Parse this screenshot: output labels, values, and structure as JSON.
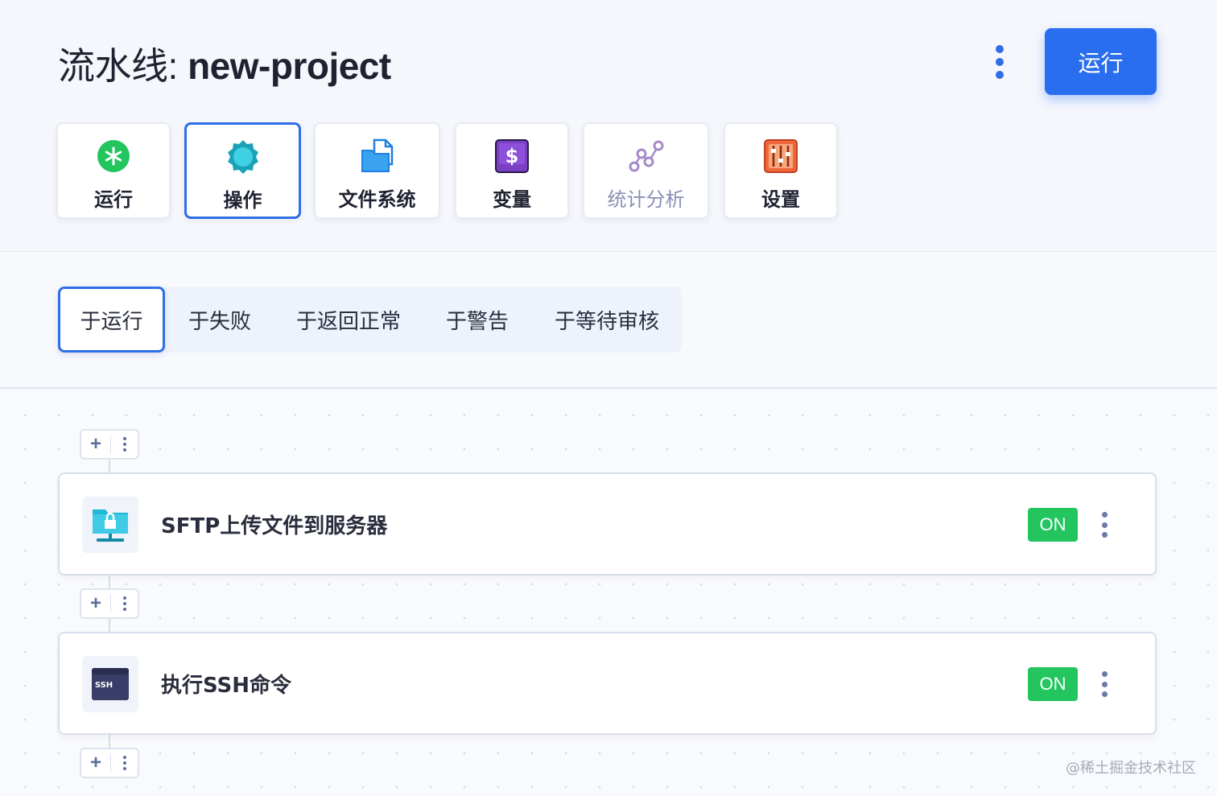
{
  "header": {
    "title_prefix": "流水线: ",
    "project_name": "new-project",
    "run_button": "运行"
  },
  "tools": [
    {
      "label": "运行",
      "icon": "asterisk-icon",
      "active": false
    },
    {
      "label": "操作",
      "icon": "gear-badge-icon",
      "active": true
    },
    {
      "label": "文件系统",
      "icon": "file-folder-icon",
      "active": false
    },
    {
      "label": "变量",
      "icon": "dollar-box-icon",
      "active": false
    },
    {
      "label": "统计分析",
      "icon": "analytics-nodes-icon",
      "active": false,
      "muted": true
    },
    {
      "label": "设置",
      "icon": "sliders-icon",
      "active": false
    }
  ],
  "event_tabs": [
    {
      "label": "于运行",
      "active": true
    },
    {
      "label": "于失败",
      "active": false
    },
    {
      "label": "于返回正常",
      "active": false
    },
    {
      "label": "于警告",
      "active": false
    },
    {
      "label": "于等待审核",
      "active": false
    }
  ],
  "adder": {
    "plus": "+"
  },
  "steps": [
    {
      "name": "SFTP上传文件到服务器",
      "icon": "sftp-upload-icon",
      "status": "ON"
    },
    {
      "name": "执行SSH命令",
      "icon": "ssh-terminal-icon",
      "status": "ON",
      "icon_text": "SSH"
    }
  ],
  "watermark": "@稀土掘金技术社区",
  "colors": {
    "accent": "#2a6ef0",
    "toggle_on": "#22c55e",
    "muted_text": "#8a8fb4"
  }
}
